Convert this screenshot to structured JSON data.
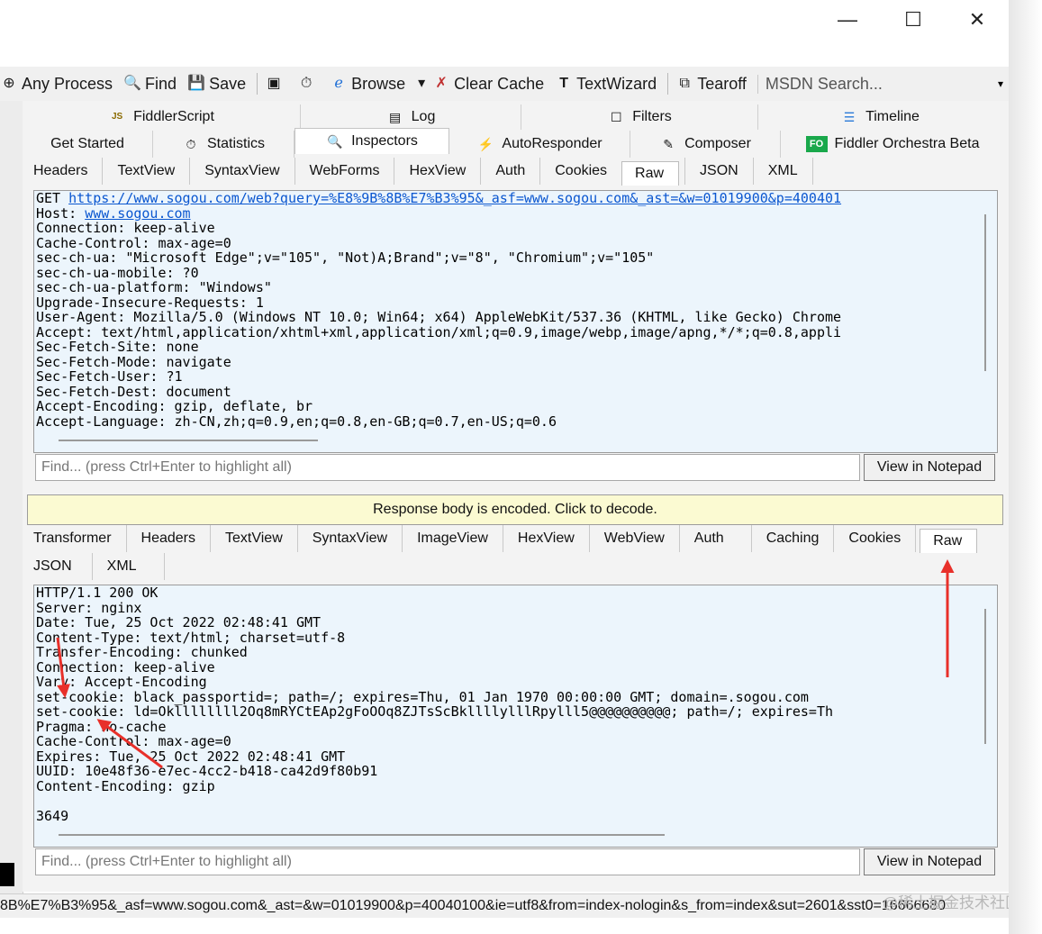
{
  "window_controls": {
    "minimize": "—",
    "maximize": "☐",
    "close": "✕"
  },
  "toolbar": {
    "items": [
      {
        "icon": "crosshair-icon",
        "glyph": "⊕",
        "label": "Any Process"
      },
      {
        "icon": "binoculars-icon",
        "glyph": "🔍",
        "label": "Find"
      },
      {
        "icon": "save-icon",
        "glyph": "💾",
        "label": "Save"
      },
      {
        "icon": "snapshot-icon",
        "glyph": "▣",
        "label": ""
      },
      {
        "icon": "timer-icon",
        "glyph": "⏱",
        "label": ""
      },
      {
        "icon": "browser-icon",
        "glyph": "ℯ",
        "label": "Browse"
      },
      {
        "icon": "dropdown-icon",
        "glyph": "▾",
        "label": ""
      },
      {
        "icon": "clear-cache-icon",
        "glyph": "✗",
        "label": "Clear Cache"
      },
      {
        "icon": "textwizard-icon",
        "glyph": "T",
        "label": "TextWizard"
      },
      {
        "icon": "tearoff-icon",
        "glyph": "⧉",
        "label": "Tearoff"
      }
    ],
    "search_placeholder": "MSDN Search..."
  },
  "top_tabs_row1": [
    {
      "icon": "fiddlerscript-icon",
      "glyph": "JS",
      "label": "FiddlerScript"
    },
    {
      "icon": "log-icon",
      "glyph": "▤",
      "label": "Log"
    },
    {
      "icon": "filters-icon",
      "glyph": "☐",
      "label": "Filters"
    },
    {
      "icon": "timeline-icon",
      "glyph": "☰",
      "label": "Timeline"
    }
  ],
  "top_tabs_row2": [
    {
      "icon": "",
      "glyph": "",
      "label": "Get Started"
    },
    {
      "icon": "statistics-icon",
      "glyph": "⏱",
      "label": "Statistics"
    },
    {
      "icon": "inspectors-icon",
      "glyph": "🔍",
      "label": "Inspectors"
    },
    {
      "icon": "autoresponder-icon",
      "glyph": "⚡",
      "label": "AutoResponder"
    },
    {
      "icon": "composer-icon",
      "glyph": "✎",
      "label": "Composer"
    },
    {
      "icon": "fo-icon",
      "glyph": "FO",
      "label": "Fiddler Orchestra Beta"
    }
  ],
  "request_tabs": [
    "Headers",
    "TextView",
    "SyntaxView",
    "WebForms",
    "HexView",
    "Auth",
    "Cookies",
    "Raw",
    "JSON",
    "XML"
  ],
  "request_active_tab": "Raw",
  "request_raw": {
    "first_prefix": "GET ",
    "first_url": "https://www.sogou.com/web?query=%E8%9B%8B%E7%B3%95&_asf=www.sogou.com&_ast=&w=01019900&p=400401",
    "host_prefix": "Host: ",
    "host_url": "www.sogou.com",
    "lines": [
      "Connection: keep-alive",
      "Cache-Control: max-age=0",
      "sec-ch-ua: \"Microsoft Edge\";v=\"105\", \"Not)A;Brand\";v=\"8\", \"Chromium\";v=\"105\"",
      "sec-ch-ua-mobile: ?0",
      "sec-ch-ua-platform: \"Windows\"",
      "Upgrade-Insecure-Requests: 1",
      "User-Agent: Mozilla/5.0 (Windows NT 10.0; Win64; x64) AppleWebKit/537.36 (KHTML, like Gecko) Chrome",
      "Accept: text/html,application/xhtml+xml,application/xml;q=0.9,image/webp,image/apng,*/*;q=0.8,appli",
      "Sec-Fetch-Site: none",
      "Sec-Fetch-Mode: navigate",
      "Sec-Fetch-User: ?1",
      "Sec-Fetch-Dest: document",
      "Accept-Encoding: gzip, deflate, br",
      "Accept-Language: zh-CN,zh;q=0.9,en;q=0.8,en-GB;q=0.7,en-US;q=0.6"
    ]
  },
  "find_placeholder": "Find... (press Ctrl+Enter to highlight all)",
  "view_notepad_label": "View in Notepad",
  "response_banner": "Response body is encoded. Click to decode.",
  "response_tabs_row1": [
    "Transformer",
    "Headers",
    "TextView",
    "SyntaxView",
    "ImageView",
    "HexView",
    "WebView",
    "Auth",
    "Caching",
    "Cookies",
    "Raw"
  ],
  "response_tabs_row2": [
    "JSON",
    "XML"
  ],
  "response_active_tab": "Raw",
  "response_raw": [
    "HTTP/1.1 200 OK",
    "Server: nginx",
    "Date: Tue, 25 Oct 2022 02:48:41 GMT",
    "Content-Type: text/html; charset=utf-8",
    "Transfer-Encoding: chunked",
    "Connection: keep-alive",
    "Vary: Accept-Encoding",
    "set-cookie: black_passportid=; path=/; expires=Thu, 01 Jan 1970 00:00:00 GMT; domain=.sogou.com",
    "set-cookie: ld=Okllllllll2Oq8mRYCtEAp2gFoOOq8ZJTsScBkllllylllRpylll5@@@@@@@@@@; path=/; expires=Th",
    "Pragma: no-cache",
    "Cache-Control: max-age=0",
    "Expires: Tue, 25 Oct 2022 02:48:41 GMT",
    "UUID: 10e48f36-e7ec-4cc2-b418-ca42d9f80b91",
    "Content-Encoding: gzip",
    "",
    "3649"
  ],
  "status_bar": "8B%E7%B3%95&_asf=www.sogou.com&_ast=&w=01019900&p=40040100&ie=utf8&from=index-nologin&s_from=index&sut=2601&sst0=16666680",
  "watermark": "@稀土掘金技术社区",
  "annotation_color": "#e8302a"
}
